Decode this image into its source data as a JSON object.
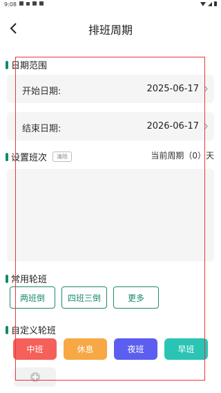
{
  "status_bar": {
    "time": "9:08"
  },
  "header": {
    "title": "排班周期"
  },
  "date_range": {
    "section_title": "日期范围",
    "start_label": "开始日期:",
    "start_value": "2025-06-17",
    "end_label": "结束日期:",
    "end_value": "2026-06-17"
  },
  "shift_setting": {
    "section_title": "设置班次",
    "clear_label": "清除",
    "cycle_text": "当前周期（0）天"
  },
  "common_rotation": {
    "section_title": "常用轮班",
    "buttons": [
      "两班倒",
      "四班三倒",
      "更多"
    ],
    "accent_color": "#1a8a6f"
  },
  "custom_rotation": {
    "section_title": "自定义轮班",
    "shifts": [
      {
        "label": "中班",
        "color": "#f5605a"
      },
      {
        "label": "休息",
        "color": "#f7a845"
      },
      {
        "label": "夜班",
        "color": "#5b5ef0"
      },
      {
        "label": "早班",
        "color": "#2bc4b4"
      }
    ]
  }
}
